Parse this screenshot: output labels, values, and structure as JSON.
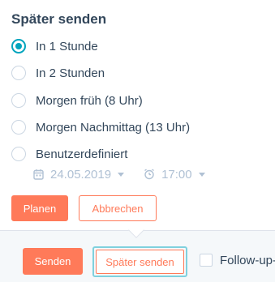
{
  "popover": {
    "title": "Später senden",
    "options": [
      {
        "label": "In 1 Stunde",
        "checked": true
      },
      {
        "label": "In 2 Stunden",
        "checked": false
      },
      {
        "label": "Morgen früh (8 Uhr)",
        "checked": false
      },
      {
        "label": "Morgen Nachmittag (13 Uhr)",
        "checked": false
      },
      {
        "label": "Benutzerdefiniert",
        "checked": false
      }
    ],
    "custom": {
      "date": "24.05.2019",
      "time": "17:00",
      "date_icon": "calendar-icon",
      "time_icon": "alarm-clock-icon"
    },
    "schedule_label": "Planen",
    "cancel_label": "Abbrechen"
  },
  "footer": {
    "send_label": "Senden",
    "send_later_label": "Später senden",
    "follow_up_label": "Follow-up-",
    "follow_up_checked": false
  },
  "colors": {
    "accent": "#ff7a59",
    "radio_selected": "#00a4bd",
    "text": "#33475b",
    "muted": "#b0c1d4"
  }
}
